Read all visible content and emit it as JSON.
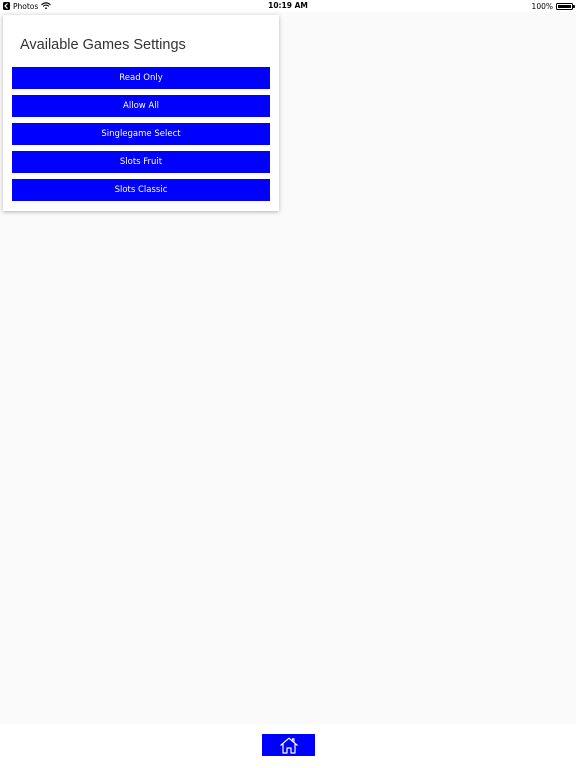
{
  "status_bar": {
    "back_app": "Photos",
    "time": "10:19 AM",
    "battery": "100%",
    "battery_level_percent": 100
  },
  "settings_card": {
    "title": "Available Games Settings",
    "buttons": [
      {
        "label": "Read Only"
      },
      {
        "label": "Allow All"
      },
      {
        "label": "Singlegame Select"
      },
      {
        "label": "Slots Fruit"
      },
      {
        "label": "Slots Classic"
      }
    ]
  },
  "bottom_bar": {
    "home_icon": "home-icon"
  },
  "colors": {
    "button_bg": "#0000ff",
    "button_text": "#ffffff",
    "page_bg": "#fafafa",
    "card_bg": "#ffffff"
  }
}
